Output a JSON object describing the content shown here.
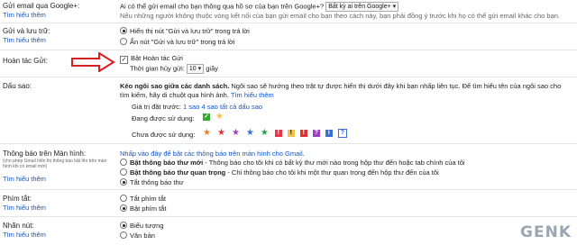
{
  "google_plus": {
    "label": "Gửi email qua Google+:",
    "learn": "Tìm hiểu thêm",
    "question": "Ai có thể gửi email cho bạn thông qua hồ sơ của bạn trên Google+?",
    "select_value": "Bất kỳ ai trên Google+",
    "desc": "Nếu những người không thuộc vòng kết nối của bạn gửi email cho bạn theo cách này, bạn phải đồng ý trước khi họ có thể gửi email khác cho bạn."
  },
  "send_archive": {
    "label": "Gửi và lưu trữ:",
    "learn": "Tìm hiểu thêm",
    "opt_show": "Hiển thị nút \"Gửi và lưu trữ\" trong trả lời",
    "opt_hide": "Ẩn nút \"Gửi và lưu trữ\" trong trả lời"
  },
  "undo_send": {
    "label": "Hoàn tác Gửi:",
    "checkbox": "Bật Hoàn tác Gửi",
    "period_label": "Thời gian hủy gửi:",
    "period_value": "10",
    "period_unit": "giây"
  },
  "stars": {
    "label": "Dấu sao:",
    "drag_bold": "Kéo ngôi sao giữa các danh sách.",
    "drag_desc": " Ngôi sao sẽ hướng theo trật tự được hiển thị dưới đây khi bạn nhấp liên tục. Để tìm hiểu tên của ngôi sao cho tìm kiếm, hãy di chuột qua hình ảnh.",
    "learn": "Tìm hiểu thêm",
    "presets_label": "Giá trị đặt trước:",
    "preset_1": "1 sao",
    "preset_4": "4 sao",
    "preset_all": "tất cả dấu sao",
    "in_use_label": "Đang được sử dụng:",
    "not_in_use_label": "Chưa được sử dụng:"
  },
  "notifications": {
    "label": "Thông báo trên Màn hình:",
    "note": "(cho phép Gmail hiển thị thông báo bật lên trên màn hình khi có email mới)",
    "learn": "Tìm hiểu thêm",
    "enable_link": "Nhấp vào đây để bật các thông báo trên màn hình cho Gmail.",
    "opt_new_bold": "Bật thông báo thư mới",
    "opt_new_desc": " - Thông báo cho tôi khi có bất kỳ thư mới nào trong hộp thư đến hoặc tab chính của tôi",
    "opt_important_bold": "Bật thông báo thư quan trọng",
    "opt_important_desc": " - Chỉ thông báo cho tôi khi một thư quan trọng đến hộp thư đến của tôi",
    "opt_off": "Tắt thông báo thư"
  },
  "shortcuts": {
    "label": "Phím tắt:",
    "learn": "Tìm hiểu thêm",
    "opt_off": "Tắt phím tắt",
    "opt_on": "Bật phím tắt"
  },
  "button_labels": {
    "label": "Nhãn nút:",
    "learn": "Tìm hiểu thêm",
    "opt_icons": "Biểu tượng",
    "opt_text": "Văn bản"
  },
  "watermark": "GENK",
  "colors": {
    "link": "#1155cc",
    "arrow": "#d42020"
  }
}
